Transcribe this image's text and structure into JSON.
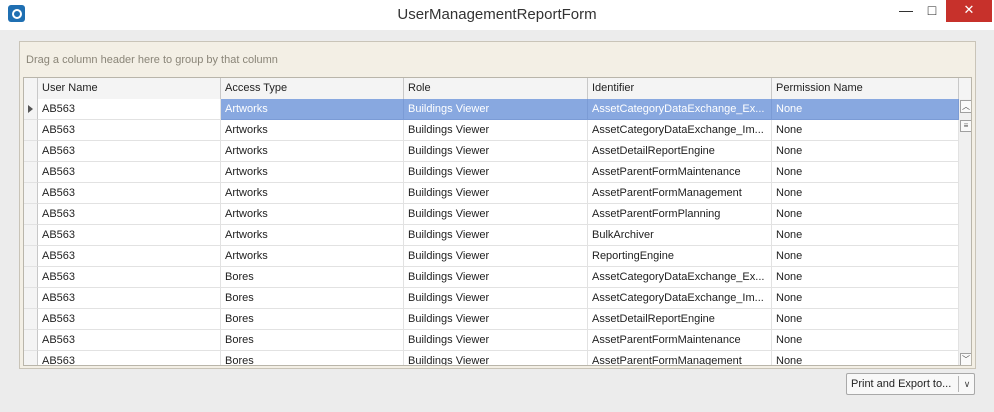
{
  "window": {
    "title": "UserManagementReportForm",
    "minimize_glyph": "—",
    "maximize_glyph": "□",
    "close_glyph": "✕",
    "app_icon": "app-logo-icon"
  },
  "grid": {
    "group_hint": "Drag a column header here to group by that column",
    "columns": [
      "User Name",
      "Access Type",
      "Role",
      "Identifier",
      "Permission Name"
    ],
    "rows": [
      [
        "AB563",
        "Artworks",
        "Buildings Viewer",
        "AssetCategoryDataExchange_Ex...",
        "None"
      ],
      [
        "AB563",
        "Artworks",
        "Buildings Viewer",
        "AssetCategoryDataExchange_Im...",
        "None"
      ],
      [
        "AB563",
        "Artworks",
        "Buildings Viewer",
        "AssetDetailReportEngine",
        "None"
      ],
      [
        "AB563",
        "Artworks",
        "Buildings Viewer",
        "AssetParentFormMaintenance",
        "None"
      ],
      [
        "AB563",
        "Artworks",
        "Buildings Viewer",
        "AssetParentFormManagement",
        "None"
      ],
      [
        "AB563",
        "Artworks",
        "Buildings Viewer",
        "AssetParentFormPlanning",
        "None"
      ],
      [
        "AB563",
        "Artworks",
        "Buildings Viewer",
        "BulkArchiver",
        "None"
      ],
      [
        "AB563",
        "Artworks",
        "Buildings Viewer",
        "ReportingEngine",
        "None"
      ],
      [
        "AB563",
        "Bores",
        "Buildings Viewer",
        "AssetCategoryDataExchange_Ex...",
        "None"
      ],
      [
        "AB563",
        "Bores",
        "Buildings Viewer",
        "AssetCategoryDataExchange_Im...",
        "None"
      ],
      [
        "AB563",
        "Bores",
        "Buildings Viewer",
        "AssetDetailReportEngine",
        "None"
      ],
      [
        "AB563",
        "Bores",
        "Buildings Viewer",
        "AssetParentFormMaintenance",
        "None"
      ],
      [
        "AB563",
        "Bores",
        "Buildings Viewer",
        "AssetParentFormManagement",
        "None"
      ]
    ],
    "selected_row": 0,
    "scroll_up_glyph": "︿",
    "scroll_down_glyph": "﹀",
    "scroll_thumb_glyph": "≡"
  },
  "footer": {
    "print_label": "Print and Export to...",
    "print_chevron": "∨"
  }
}
